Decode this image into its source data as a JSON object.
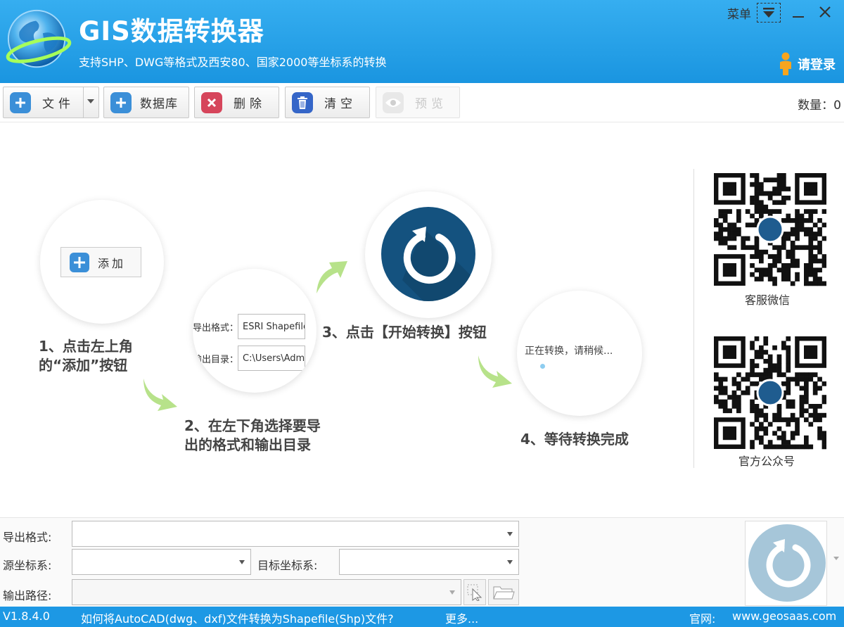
{
  "header": {
    "title": "GIS数据转换器",
    "subtitle": "支持SHP、DWG等格式及西安80、国家2000等坐标系的转换",
    "menu_label": "菜单",
    "login_label": "请登录"
  },
  "toolbar": {
    "file_label": "文件",
    "database_label": "数据库",
    "delete_label": "删除",
    "clear_label": "清空",
    "preview_label": "预览",
    "count_label": "数量：",
    "count_value": "0"
  },
  "guide": {
    "step1_line1": "1、点击左上角",
    "step1_line2": "的“添加”按钮",
    "add_button_label": "添加",
    "export_format_label": "导出格式：",
    "export_format_value": "ESRI Shapefile",
    "output_dir_label": "输出目录：",
    "output_dir_value": "C:\\Users\\Adm",
    "step2_line1": "2、在左下角选择要导",
    "step2_line2": "出的格式和输出目录",
    "step3": "3、点击【开始转换】按钮",
    "progress_text": "正在转换，请稍候...",
    "step4": "4、等待转换完成"
  },
  "qr": {
    "wechat_label": "客服微信",
    "official_label": "官方公众号"
  },
  "settings": {
    "export_format_label": "导出格式:",
    "export_format_value": "",
    "source_crs_label": "源坐标系:",
    "source_crs_value": "",
    "target_crs_label": "目标坐标系:",
    "target_crs_value": "",
    "output_path_label": "输出路径:",
    "output_path_value": ""
  },
  "status": {
    "version": "V1.8.4.0",
    "help_link": "如何将AutoCAD(dwg、dxf)文件转换为Shapefile(Shp)文件?",
    "more_link": "更多...",
    "site_label": "官网:",
    "site_url": "www.geosaas.com"
  },
  "colors": {
    "header_blue": "#1e9be6",
    "add_icon_blue": "#3b8fd8",
    "delete_icon_red": "#d6455b",
    "clear_icon_blue": "#3566c8",
    "start_icon_navy": "#14527f",
    "arrow_green": "#b7e28a"
  },
  "icons": [
    "globe-logo-icon",
    "chevron-down-icon",
    "minimize-icon",
    "close-icon",
    "user-icon",
    "plus-icon",
    "delete-x-icon",
    "trash-icon",
    "eye-icon",
    "refresh-icon",
    "arrow-icon",
    "qr-code-icon",
    "cursor-pick-icon",
    "folder-icon"
  ]
}
